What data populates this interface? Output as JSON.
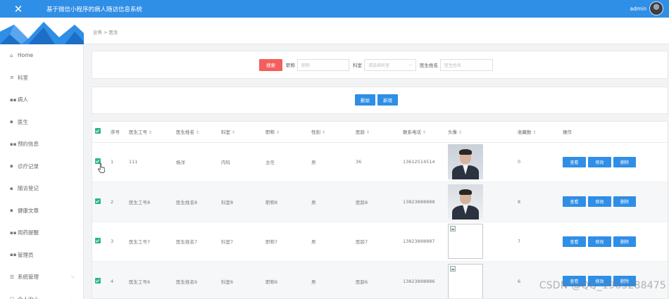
{
  "topbar": {
    "title": "基于微信小程序的病人随访信息系统",
    "user": "admin"
  },
  "sidebar": {
    "items": [
      {
        "label": "Home",
        "icon": "⌂"
      },
      {
        "label": "科室",
        "icon": "≡"
      },
      {
        "label": "病人",
        "icon": "▪▪"
      },
      {
        "label": "医生",
        "icon": "▪"
      },
      {
        "label": "预约信息",
        "icon": "▪▪"
      },
      {
        "label": "诊疗记录",
        "icon": "▪"
      },
      {
        "label": "随访登记",
        "icon": "▪"
      },
      {
        "label": "健康文章",
        "icon": "▪"
      },
      {
        "label": "用药提醒",
        "icon": "▪▪"
      },
      {
        "label": "管理员",
        "icon": "▪▪"
      },
      {
        "label": "系统管理",
        "icon": "☰"
      },
      {
        "label": "个人中心",
        "icon": "▢"
      }
    ]
  },
  "breadcrumb": "业务 > 医生",
  "search": {
    "button": "搜索",
    "label_title": "职称",
    "placeholder_title": "职称",
    "label_dept": "科室",
    "placeholder_dept": "请选择科室",
    "label_name": "医生姓名",
    "placeholder_name": "医生姓名"
  },
  "actions": {
    "delete": "删除",
    "add": "新增"
  },
  "table": {
    "headers": [
      "序号",
      "医生工号",
      "医生姓名",
      "科室",
      "职称",
      "性别",
      "医龄",
      "联系电话",
      "头像",
      "收藏数",
      "操作"
    ],
    "rows": [
      {
        "idx": "1",
        "no": "111",
        "name": "杨洋",
        "dept": "内科",
        "title": "主任",
        "sex": "男",
        "age": "36",
        "phone": "13612514514",
        "fav": "0",
        "photo": "photo-a"
      },
      {
        "idx": "2",
        "no": "医生工号8",
        "name": "医生姓名8",
        "dept": "科室8",
        "title": "职称8",
        "sex": "男",
        "age": "医龄8",
        "phone": "13823888888",
        "fav": "8",
        "photo": "photo-b"
      },
      {
        "idx": "3",
        "no": "医生工号7",
        "name": "医生姓名7",
        "dept": "科室7",
        "title": "职称7",
        "sex": "男",
        "age": "医龄7",
        "phone": "13823888887",
        "fav": "7",
        "photo": "broken"
      },
      {
        "idx": "4",
        "no": "医生工号6",
        "name": "医生姓名6",
        "dept": "科室6",
        "title": "职称6",
        "sex": "男",
        "age": "医龄6",
        "phone": "13823888886",
        "fav": "6",
        "photo": "broken"
      }
    ],
    "op_view": "查看",
    "op_edit": "修改",
    "op_delete": "删除"
  },
  "watermark": "CSDN @QQ_1963288475",
  "colors": {
    "primary": "#2f8ee6",
    "danger": "#f35f5d",
    "check": "#2ab48a"
  }
}
